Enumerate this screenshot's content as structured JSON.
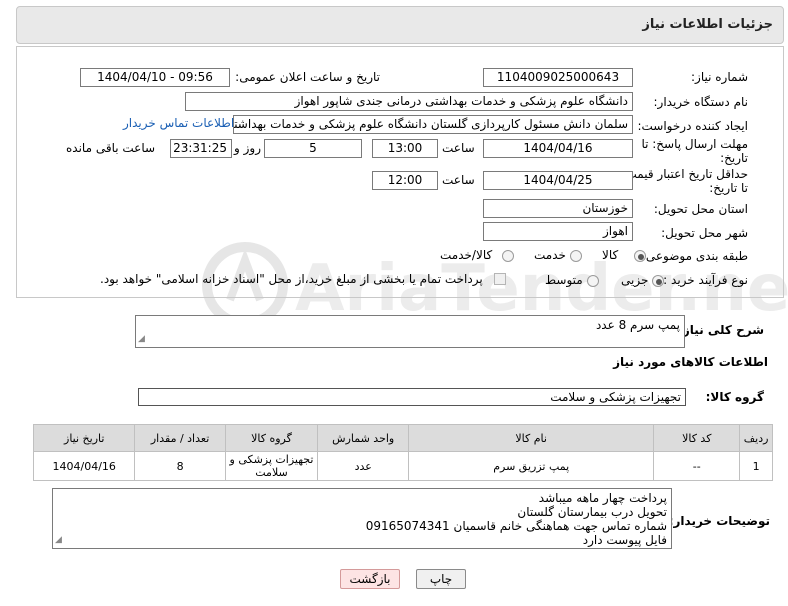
{
  "header": {
    "title": "جزئیات اطلاعات نیاز"
  },
  "form": {
    "need_number_label": "شماره نیاز:",
    "need_number": "1104009025000643",
    "announce_label": "تاریخ و ساعت اعلان عمومی:",
    "announce_value": "1404/04/10 - 09:56",
    "buyer_org_label": "نام دستگاه خریدار:",
    "buyer_org": "دانشگاه علوم پزشکی و خدمات بهداشتی درمانی جندی شاپور اهواز",
    "requester_label": "ایجاد کننده درخواست:",
    "requester": "سلمان دانش مسئول کارپردازی گلستان دانشگاه علوم پزشکی و خدمات بهداشتی",
    "contact_link": "اطلاعات تماس خریدار",
    "deadline_label_1": "مهلت ارسال پاسخ: تا",
    "deadline_label_2": "تاریخ:",
    "deadline_date": "1404/04/16",
    "time_label": "ساعت",
    "deadline_time": "13:00",
    "days_value": "5",
    "days_label": "روز و",
    "remaining_time": "23:31:25",
    "remaining_label": "ساعت باقی مانده",
    "validity_label_1": "حداقل تاریخ اعتبار قیمت:",
    "validity_label_2": "تا تاریخ:",
    "validity_date": "1404/04/25",
    "validity_time": "12:00",
    "province_label": "استان محل تحویل:",
    "province": "خوزستان",
    "city_label": "شهر محل تحویل:",
    "city": "اهواز",
    "category_label": "طبقه بندی موضوعی:",
    "category_options": [
      "کالا",
      "خدمت",
      "کالا/خدمت"
    ],
    "category_selected": "کالا",
    "process_label": "نوع فرآیند خرید :",
    "process_options": [
      "جزیی",
      "متوسط"
    ],
    "process_selected": "جزیی",
    "payment_note": "پرداخت تمام یا بخشی از مبلغ خرید،از محل \"اسناد خزانه اسلامی\" خواهد بود."
  },
  "description": {
    "label": "شرح کلی نیاز:",
    "value": "پمپ سرم 8 عدد"
  },
  "goods": {
    "section_title": "اطلاعات کالاهای مورد نیاز",
    "group_label": "گروه کالا:",
    "group_value": "تجهیزات پزشکی و سلامت",
    "columns": [
      "ردیف",
      "کد کالا",
      "نام کالا",
      "واحد شمارش",
      "گروه کالا",
      "تعداد / مقدار",
      "تاریخ نیاز"
    ],
    "rows": [
      {
        "row": "1",
        "code": "--",
        "name": "پمپ تزریق سرم",
        "unit": "عدد",
        "group": "تجهیزات پزشکی و سلامت",
        "qty": "8",
        "date": "1404/04/16"
      }
    ]
  },
  "buyer_notes": {
    "label": "توضیحات خریدار:",
    "lines": [
      "پرداخت چهار ماهه میباشد",
      "تحویل درب بیمارستان گلستان",
      "شماره تماس جهت هماهنگی خانم قاسمیان 09165074341",
      "فایل پیوست دارد"
    ]
  },
  "buttons": {
    "print": "چاپ",
    "back": "بازگشت"
  },
  "watermark": {
    "text": "AriaTender.neT"
  },
  "colors": {
    "link": "#1a5fb4",
    "header_bg": "#e9e9e9",
    "back_button_bg": "#fde4e4"
  }
}
